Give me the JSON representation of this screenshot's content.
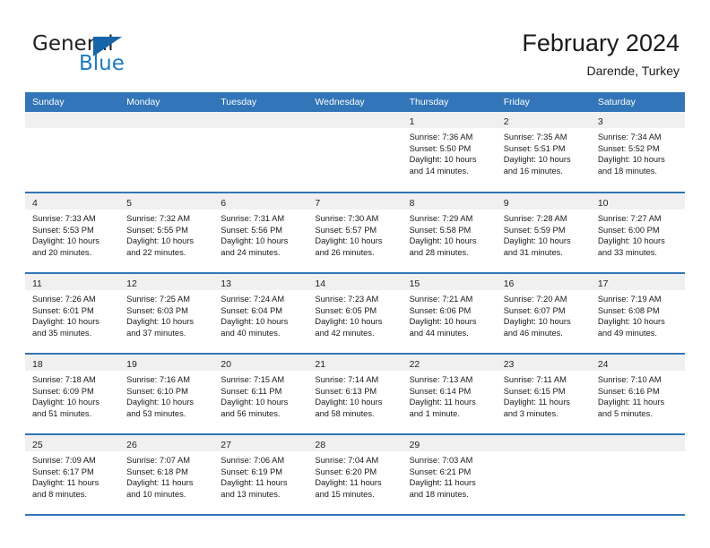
{
  "brand": {
    "name_part1": "General",
    "name_part2": "Blue",
    "triangle_color": "#1565a8",
    "blue_text_color": "#1f7bc1"
  },
  "header": {
    "title": "February 2024",
    "subtitle": "Darende, Turkey"
  },
  "theme": {
    "header_blue": "#3275b8",
    "band_gray": "#f0f0f0",
    "text": "#1a1a1a"
  },
  "weekdays": [
    "Sunday",
    "Monday",
    "Tuesday",
    "Wednesday",
    "Thursday",
    "Friday",
    "Saturday"
  ],
  "weeks": [
    [
      {
        "empty": true
      },
      {
        "empty": true
      },
      {
        "empty": true
      },
      {
        "empty": true
      },
      {
        "day": "1",
        "sunrise": "Sunrise: 7:36 AM",
        "sunset": "Sunset: 5:50 PM",
        "daylight_line1": "Daylight: 10 hours",
        "daylight_line2": "and 14 minutes."
      },
      {
        "day": "2",
        "sunrise": "Sunrise: 7:35 AM",
        "sunset": "Sunset: 5:51 PM",
        "daylight_line1": "Daylight: 10 hours",
        "daylight_line2": "and 16 minutes."
      },
      {
        "day": "3",
        "sunrise": "Sunrise: 7:34 AM",
        "sunset": "Sunset: 5:52 PM",
        "daylight_line1": "Daylight: 10 hours",
        "daylight_line2": "and 18 minutes."
      }
    ],
    [
      {
        "day": "4",
        "sunrise": "Sunrise: 7:33 AM",
        "sunset": "Sunset: 5:53 PM",
        "daylight_line1": "Daylight: 10 hours",
        "daylight_line2": "and 20 minutes."
      },
      {
        "day": "5",
        "sunrise": "Sunrise: 7:32 AM",
        "sunset": "Sunset: 5:55 PM",
        "daylight_line1": "Daylight: 10 hours",
        "daylight_line2": "and 22 minutes."
      },
      {
        "day": "6",
        "sunrise": "Sunrise: 7:31 AM",
        "sunset": "Sunset: 5:56 PM",
        "daylight_line1": "Daylight: 10 hours",
        "daylight_line2": "and 24 minutes."
      },
      {
        "day": "7",
        "sunrise": "Sunrise: 7:30 AM",
        "sunset": "Sunset: 5:57 PM",
        "daylight_line1": "Daylight: 10 hours",
        "daylight_line2": "and 26 minutes."
      },
      {
        "day": "8",
        "sunrise": "Sunrise: 7:29 AM",
        "sunset": "Sunset: 5:58 PM",
        "daylight_line1": "Daylight: 10 hours",
        "daylight_line2": "and 28 minutes."
      },
      {
        "day": "9",
        "sunrise": "Sunrise: 7:28 AM",
        "sunset": "Sunset: 5:59 PM",
        "daylight_line1": "Daylight: 10 hours",
        "daylight_line2": "and 31 minutes."
      },
      {
        "day": "10",
        "sunrise": "Sunrise: 7:27 AM",
        "sunset": "Sunset: 6:00 PM",
        "daylight_line1": "Daylight: 10 hours",
        "daylight_line2": "and 33 minutes."
      }
    ],
    [
      {
        "day": "11",
        "sunrise": "Sunrise: 7:26 AM",
        "sunset": "Sunset: 6:01 PM",
        "daylight_line1": "Daylight: 10 hours",
        "daylight_line2": "and 35 minutes."
      },
      {
        "day": "12",
        "sunrise": "Sunrise: 7:25 AM",
        "sunset": "Sunset: 6:03 PM",
        "daylight_line1": "Daylight: 10 hours",
        "daylight_line2": "and 37 minutes."
      },
      {
        "day": "13",
        "sunrise": "Sunrise: 7:24 AM",
        "sunset": "Sunset: 6:04 PM",
        "daylight_line1": "Daylight: 10 hours",
        "daylight_line2": "and 40 minutes."
      },
      {
        "day": "14",
        "sunrise": "Sunrise: 7:23 AM",
        "sunset": "Sunset: 6:05 PM",
        "daylight_line1": "Daylight: 10 hours",
        "daylight_line2": "and 42 minutes."
      },
      {
        "day": "15",
        "sunrise": "Sunrise: 7:21 AM",
        "sunset": "Sunset: 6:06 PM",
        "daylight_line1": "Daylight: 10 hours",
        "daylight_line2": "and 44 minutes."
      },
      {
        "day": "16",
        "sunrise": "Sunrise: 7:20 AM",
        "sunset": "Sunset: 6:07 PM",
        "daylight_line1": "Daylight: 10 hours",
        "daylight_line2": "and 46 minutes."
      },
      {
        "day": "17",
        "sunrise": "Sunrise: 7:19 AM",
        "sunset": "Sunset: 6:08 PM",
        "daylight_line1": "Daylight: 10 hours",
        "daylight_line2": "and 49 minutes."
      }
    ],
    [
      {
        "day": "18",
        "sunrise": "Sunrise: 7:18 AM",
        "sunset": "Sunset: 6:09 PM",
        "daylight_line1": "Daylight: 10 hours",
        "daylight_line2": "and 51 minutes."
      },
      {
        "day": "19",
        "sunrise": "Sunrise: 7:16 AM",
        "sunset": "Sunset: 6:10 PM",
        "daylight_line1": "Daylight: 10 hours",
        "daylight_line2": "and 53 minutes."
      },
      {
        "day": "20",
        "sunrise": "Sunrise: 7:15 AM",
        "sunset": "Sunset: 6:11 PM",
        "daylight_line1": "Daylight: 10 hours",
        "daylight_line2": "and 56 minutes."
      },
      {
        "day": "21",
        "sunrise": "Sunrise: 7:14 AM",
        "sunset": "Sunset: 6:13 PM",
        "daylight_line1": "Daylight: 10 hours",
        "daylight_line2": "and 58 minutes."
      },
      {
        "day": "22",
        "sunrise": "Sunrise: 7:13 AM",
        "sunset": "Sunset: 6:14 PM",
        "daylight_line1": "Daylight: 11 hours",
        "daylight_line2": "and 1 minute."
      },
      {
        "day": "23",
        "sunrise": "Sunrise: 7:11 AM",
        "sunset": "Sunset: 6:15 PM",
        "daylight_line1": "Daylight: 11 hours",
        "daylight_line2": "and 3 minutes."
      },
      {
        "day": "24",
        "sunrise": "Sunrise: 7:10 AM",
        "sunset": "Sunset: 6:16 PM",
        "daylight_line1": "Daylight: 11 hours",
        "daylight_line2": "and 5 minutes."
      }
    ],
    [
      {
        "day": "25",
        "sunrise": "Sunrise: 7:09 AM",
        "sunset": "Sunset: 6:17 PM",
        "daylight_line1": "Daylight: 11 hours",
        "daylight_line2": "and 8 minutes."
      },
      {
        "day": "26",
        "sunrise": "Sunrise: 7:07 AM",
        "sunset": "Sunset: 6:18 PM",
        "daylight_line1": "Daylight: 11 hours",
        "daylight_line2": "and 10 minutes."
      },
      {
        "day": "27",
        "sunrise": "Sunrise: 7:06 AM",
        "sunset": "Sunset: 6:19 PM",
        "daylight_line1": "Daylight: 11 hours",
        "daylight_line2": "and 13 minutes."
      },
      {
        "day": "28",
        "sunrise": "Sunrise: 7:04 AM",
        "sunset": "Sunset: 6:20 PM",
        "daylight_line1": "Daylight: 11 hours",
        "daylight_line2": "and 15 minutes."
      },
      {
        "day": "29",
        "sunrise": "Sunrise: 7:03 AM",
        "sunset": "Sunset: 6:21 PM",
        "daylight_line1": "Daylight: 11 hours",
        "daylight_line2": "and 18 minutes."
      },
      {
        "empty": true
      },
      {
        "empty": true
      }
    ]
  ]
}
